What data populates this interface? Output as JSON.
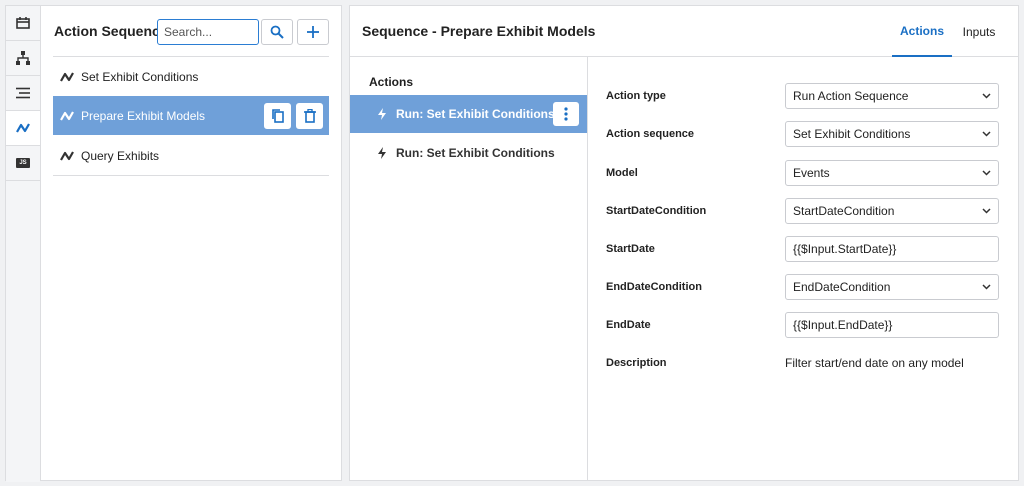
{
  "colors": {
    "accent": "#1a6fc4",
    "selected_row": "#6fa0d9"
  },
  "rail": {
    "items": [
      {
        "name": "pages-icon",
        "active": false
      },
      {
        "name": "hierarchy-icon",
        "active": false
      },
      {
        "name": "list-icon",
        "active": false
      },
      {
        "name": "action-sequences-icon",
        "active": true
      },
      {
        "name": "js-icon",
        "label": "JS",
        "active": false
      }
    ]
  },
  "list_panel": {
    "title": "Action Sequences",
    "search_placeholder": "Search...",
    "items": [
      {
        "label": "Set Exhibit Conditions"
      },
      {
        "label": "Prepare Exhibit Models",
        "selected": true
      },
      {
        "label": "Query Exhibits"
      }
    ]
  },
  "main_panel": {
    "title": "Sequence - Prepare Exhibit Models",
    "tabs": [
      {
        "label": "Actions",
        "active": true
      },
      {
        "label": "Inputs",
        "active": false
      }
    ],
    "actions_heading": "Actions",
    "actions": [
      {
        "label": "Run: Set Exhibit Conditions",
        "selected": true
      },
      {
        "label": "Run: Set Exhibit Conditions",
        "selected": false
      }
    ],
    "form": {
      "action_type": {
        "label": "Action type",
        "value": "Run Action Sequence"
      },
      "action_sequence": {
        "label": "Action sequence",
        "value": "Set Exhibit Conditions"
      },
      "model": {
        "label": "Model",
        "value": "Events"
      },
      "start_date_condition": {
        "label": "StartDateCondition",
        "value": "StartDateCondition"
      },
      "start_date": {
        "label": "StartDate",
        "value": "{{$Input.StartDate}}"
      },
      "end_date_condition": {
        "label": "EndDateCondition",
        "value": "EndDateCondition"
      },
      "end_date": {
        "label": "EndDate",
        "value": "{{$Input.EndDate}}"
      },
      "description": {
        "label": "Description",
        "value": "Filter start/end date on any model"
      }
    }
  }
}
